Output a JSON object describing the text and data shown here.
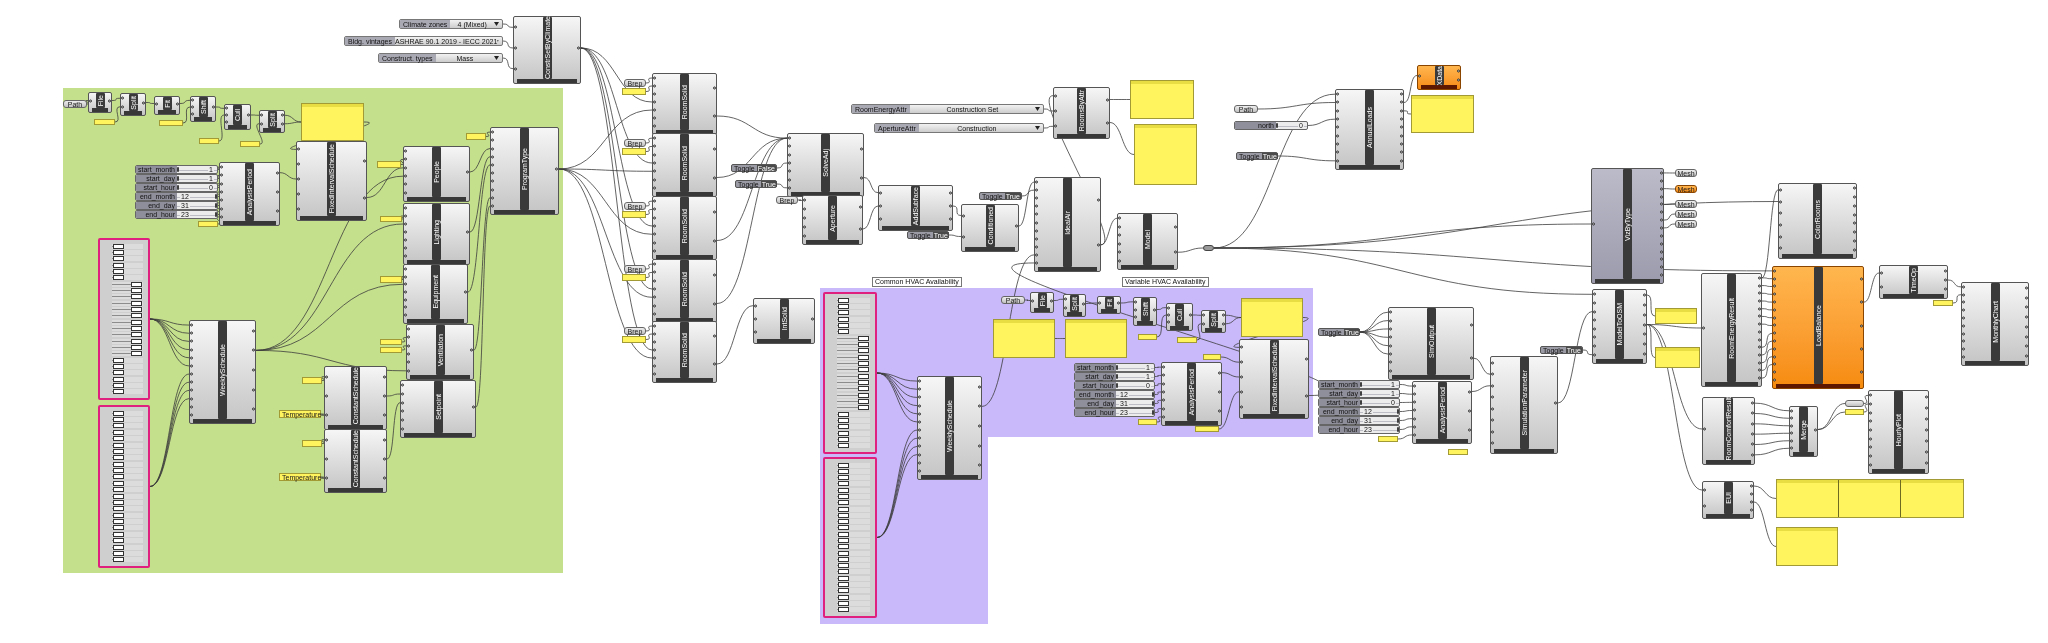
{
  "groups": [
    {
      "color": "#c5e08c"
    },
    {
      "title": "Common HVAC Availability",
      "color": "#c9b9fa"
    },
    {
      "title": "Variable HVAC Availability",
      "color": "#c9b9fa"
    }
  ],
  "nodes": [
    {
      "kind": "value_list",
      "label": "Climate zones",
      "value": "4 (Mixed)"
    },
    {
      "kind": "value_list",
      "label": "Bldg. vintages",
      "value": "ASHRAE 90.1 2019 - IECC 2021"
    },
    {
      "kind": "value_list",
      "label": "Construct. types",
      "value": "Mass"
    },
    {
      "kind": "component",
      "name": "ConstrSetByClimate",
      "warning": false,
      "preview": true
    },
    {
      "kind": "param",
      "text": "Path",
      "warning": false
    },
    {
      "kind": "component",
      "name": "File",
      "warning": false,
      "preview": true
    },
    {
      "kind": "panel"
    },
    {
      "kind": "component",
      "name": "Split",
      "warning": false,
      "preview": true
    },
    {
      "kind": "component",
      "name": "Fit",
      "warning": false,
      "preview": true
    },
    {
      "kind": "panel"
    },
    {
      "kind": "component",
      "name": "Shift",
      "warning": false,
      "preview": true
    },
    {
      "kind": "panel"
    },
    {
      "kind": "component",
      "name": "Cull",
      "warning": false,
      "preview": true
    },
    {
      "kind": "panel"
    },
    {
      "kind": "component",
      "name": "Split",
      "warning": false,
      "preview": true
    },
    {
      "kind": "panel"
    },
    {
      "kind": "slider",
      "label": "start_month",
      "value": "1",
      "level": 0
    },
    {
      "kind": "slider",
      "label": "start_day",
      "value": "1",
      "level": 0
    },
    {
      "kind": "slider",
      "label": "start_hour",
      "value": "0",
      "level": 0
    },
    {
      "kind": "slider",
      "label": "end_month",
      "value": "12",
      "level": 1
    },
    {
      "kind": "slider",
      "label": "end_day",
      "value": "31",
      "level": 1
    },
    {
      "kind": "slider",
      "label": "end_hour",
      "value": "23",
      "level": 1
    },
    {
      "kind": "panel"
    },
    {
      "kind": "component",
      "name": "AnalysisPeriod",
      "warning": false,
      "preview": true
    },
    {
      "kind": "component",
      "name": "FixedIntervalSchedule",
      "warning": false,
      "preview": true
    },
    {
      "kind": "panel"
    },
    {
      "kind": "panel"
    },
    {
      "kind": "component",
      "name": "People",
      "warning": false,
      "preview": true
    },
    {
      "kind": "panel"
    },
    {
      "kind": "component",
      "name": "Lighting",
      "warning": false,
      "preview": true
    },
    {
      "kind": "panel"
    },
    {
      "kind": "component",
      "name": "Equipment",
      "warning": false,
      "preview": true
    },
    {
      "kind": "panel"
    },
    {
      "kind": "panel"
    },
    {
      "kind": "component",
      "name": "Ventilation",
      "warning": false,
      "preview": true
    },
    {
      "kind": "component",
      "name": "ProgramType",
      "warning": false,
      "preview": true
    },
    {
      "kind": "gene_pool",
      "sliders": [
        {
          "level": 0.05
        },
        {
          "level": 0.05
        },
        {
          "level": 0.05
        },
        {
          "level": 0.05
        },
        {
          "level": 0.05
        },
        {
          "level": 0.05
        },
        {
          "level": 0.95
        },
        {
          "level": 0.95
        },
        {
          "level": 0.95
        },
        {
          "level": 0.95
        },
        {
          "level": 0.95
        },
        {
          "level": 0.95
        },
        {
          "level": 0.95
        },
        {
          "level": 0.95
        },
        {
          "level": 0.95
        },
        {
          "level": 0.95
        },
        {
          "level": 0.95
        },
        {
          "level": 0.95
        },
        {
          "level": 0.05
        },
        {
          "level": 0.05
        },
        {
          "level": 0.05
        },
        {
          "level": 0.05
        },
        {
          "level": 0.05
        },
        {
          "level": 0.05
        }
      ]
    },
    {
      "kind": "gene_pool",
      "sliders": [
        {
          "level": 0.05
        },
        {
          "level": 0.05
        },
        {
          "level": 0.05
        },
        {
          "level": 0.05
        },
        {
          "level": 0.05
        },
        {
          "level": 0.05
        },
        {
          "level": 0.05
        },
        {
          "level": 0.05
        },
        {
          "level": 0.05
        },
        {
          "level": 0.05
        },
        {
          "level": 0.05
        },
        {
          "level": 0.05
        },
        {
          "level": 0.05
        },
        {
          "level": 0.05
        },
        {
          "level": 0.05
        },
        {
          "level": 0.05
        },
        {
          "level": 0.05
        },
        {
          "level": 0.05
        },
        {
          "level": 0.05
        },
        {
          "level": 0.05
        },
        {
          "level": 0.05
        },
        {
          "level": 0.05
        },
        {
          "level": 0.05
        },
        {
          "level": 0.05
        }
      ]
    },
    {
      "kind": "component",
      "name": "WeeklySchedule",
      "warning": false,
      "preview": true
    },
    {
      "kind": "panel"
    },
    {
      "kind": "panel",
      "lines": [
        "Temperature"
      ]
    },
    {
      "kind": "component",
      "name": "ConstantSchedule",
      "warning": false,
      "preview": true
    },
    {
      "kind": "panel"
    },
    {
      "kind": "panel",
      "lines": [
        "Temperature"
      ]
    },
    {
      "kind": "component",
      "name": "ConstantSchedule",
      "warning": false,
      "preview": true
    },
    {
      "kind": "component",
      "name": "Setpoint",
      "warning": false,
      "preview": true
    },
    {
      "kind": "param",
      "text": "Brep",
      "warning": false
    },
    {
      "kind": "panel"
    },
    {
      "kind": "component",
      "name": "RoomSolid",
      "warning": false,
      "preview": true
    },
    {
      "kind": "param",
      "text": "Brep",
      "warning": false
    },
    {
      "kind": "panel"
    },
    {
      "kind": "component",
      "name": "RoomSolid",
      "warning": false,
      "preview": true
    },
    {
      "kind": "param",
      "text": "Brep",
      "warning": false
    },
    {
      "kind": "panel"
    },
    {
      "kind": "component",
      "name": "RoomSolid",
      "warning": false,
      "preview": true
    },
    {
      "kind": "param",
      "text": "Brep",
      "warning": false
    },
    {
      "kind": "panel"
    },
    {
      "kind": "component",
      "name": "RoomSolid",
      "warning": false,
      "preview": true
    },
    {
      "kind": "param",
      "text": "Brep",
      "warning": false
    },
    {
      "kind": "panel"
    },
    {
      "kind": "component",
      "name": "RoomSolid",
      "warning": false,
      "preview": true
    },
    {
      "kind": "value_list",
      "label": "RoomEnergyAttr",
      "value": "Construction Set"
    },
    {
      "kind": "value_list",
      "label": "ApertureAttr",
      "value": "Construction"
    },
    {
      "kind": "component",
      "name": "RoomsByAttr",
      "warning": false,
      "preview": true
    },
    {
      "kind": "panel"
    },
    {
      "kind": "panel"
    },
    {
      "kind": "toggle",
      "label": "Toggle",
      "value": "False"
    },
    {
      "kind": "toggle",
      "label": "Toggle",
      "value": "True"
    },
    {
      "kind": "component",
      "name": "SolveAdj",
      "warning": false,
      "preview": true
    },
    {
      "kind": "param",
      "text": "Brep",
      "warning": false
    },
    {
      "kind": "toggle",
      "label": "Toggle",
      "value": "True"
    },
    {
      "kind": "component",
      "name": "Aperture",
      "warning": false,
      "preview": true
    },
    {
      "kind": "component",
      "name": "AddSubface",
      "warning": false,
      "preview": true
    },
    {
      "kind": "component",
      "name": "Conditioned",
      "warning": false,
      "preview": true
    },
    {
      "kind": "toggle",
      "label": "Toggle",
      "value": "True"
    },
    {
      "kind": "component",
      "name": "IdealAir",
      "warning": false,
      "preview": true
    },
    {
      "kind": "component",
      "name": "IntSolid",
      "warning": false,
      "preview": true
    },
    {
      "kind": "component",
      "name": "Model",
      "warning": false,
      "preview": true
    },
    {
      "kind": "relay"
    },
    {
      "kind": "param",
      "text": "Path",
      "warning": false
    },
    {
      "kind": "slider",
      "label": "north",
      "value": "0",
      "level": 0
    },
    {
      "kind": "toggle",
      "label": "Toggle",
      "value": "True"
    },
    {
      "kind": "component",
      "name": "AnnualLoads",
      "warning": false,
      "preview": true
    },
    {
      "kind": "component",
      "name": "XData",
      "warning": true,
      "preview": true
    },
    {
      "kind": "panel"
    },
    {
      "kind": "toggle",
      "label": "Toggle",
      "value": "True"
    },
    {
      "kind": "component",
      "name": "SimOutput",
      "warning": false,
      "preview": true
    },
    {
      "kind": "slider",
      "label": "start_month",
      "value": "1",
      "level": 0
    },
    {
      "kind": "slider",
      "label": "start_day",
      "value": "1",
      "level": 0
    },
    {
      "kind": "slider",
      "label": "start_hour",
      "value": "0",
      "level": 0
    },
    {
      "kind": "slider",
      "label": "end_month",
      "value": "12",
      "level": 1
    },
    {
      "kind": "slider",
      "label": "end_day",
      "value": "31",
      "level": 1
    },
    {
      "kind": "slider",
      "label": "end_hour",
      "value": "23",
      "level": 1
    },
    {
      "kind": "panel"
    },
    {
      "kind": "component",
      "name": "AnalysisPeriod",
      "warning": false,
      "preview": true
    },
    {
      "kind": "panel"
    },
    {
      "kind": "toggle",
      "label": "Toggle",
      "value": "True"
    },
    {
      "kind": "component",
      "name": "SimulationParameter",
      "warning": false,
      "preview": true
    },
    {
      "kind": "gene_pool",
      "sliders": [
        {
          "level": 0.05
        },
        {
          "level": 0.05
        },
        {
          "level": 0.05
        },
        {
          "level": 0.05
        },
        {
          "level": 0.05
        },
        {
          "level": 0.05
        },
        {
          "level": 0.95
        },
        {
          "level": 0.95
        },
        {
          "level": 0.95
        },
        {
          "level": 0.95
        },
        {
          "level": 0.95
        },
        {
          "level": 0.95
        },
        {
          "level": 0.95
        },
        {
          "level": 0.95
        },
        {
          "level": 0.95
        },
        {
          "level": 0.95
        },
        {
          "level": 0.95
        },
        {
          "level": 0.95
        },
        {
          "level": 0.05
        },
        {
          "level": 0.05
        },
        {
          "level": 0.05
        },
        {
          "level": 0.05
        },
        {
          "level": 0.05
        },
        {
          "level": 0.05
        }
      ]
    },
    {
      "kind": "gene_pool",
      "sliders": [
        {
          "level": 0.05
        },
        {
          "level": 0.05
        },
        {
          "level": 0.05
        },
        {
          "level": 0.05
        },
        {
          "level": 0.05
        },
        {
          "level": 0.05
        },
        {
          "level": 0.05
        },
        {
          "level": 0.05
        },
        {
          "level": 0.05
        },
        {
          "level": 0.05
        },
        {
          "level": 0.05
        },
        {
          "level": 0.05
        },
        {
          "level": 0.05
        },
        {
          "level": 0.05
        },
        {
          "level": 0.05
        },
        {
          "level": 0.05
        },
        {
          "level": 0.05
        },
        {
          "level": 0.05
        },
        {
          "level": 0.05
        },
        {
          "level": 0.05
        },
        {
          "level": 0.05
        },
        {
          "level": 0.05
        },
        {
          "level": 0.05
        },
        {
          "level": 0.05
        }
      ]
    },
    {
      "kind": "component",
      "name": "WeeklySchedule",
      "warning": false,
      "preview": true
    },
    {
      "kind": "param",
      "text": "Path",
      "warning": false
    },
    {
      "kind": "component",
      "name": "File",
      "warning": false,
      "preview": true
    },
    {
      "kind": "component",
      "name": "Split",
      "warning": false,
      "preview": true
    },
    {
      "kind": "component",
      "name": "Fit",
      "warning": false,
      "preview": true
    },
    {
      "kind": "component",
      "name": "Shift",
      "warning": false,
      "preview": true
    },
    {
      "kind": "panel"
    },
    {
      "kind": "component",
      "name": "Cull",
      "warning": false,
      "preview": true
    },
    {
      "kind": "panel"
    },
    {
      "kind": "component",
      "name": "Split",
      "warning": false,
      "preview": true
    },
    {
      "kind": "panel"
    },
    {
      "kind": "panel"
    },
    {
      "kind": "panel"
    },
    {
      "kind": "slider",
      "label": "start_month",
      "value": "1",
      "level": 0
    },
    {
      "kind": "slider",
      "label": "start_day",
      "value": "1",
      "level": 0
    },
    {
      "kind": "slider",
      "label": "start_hour",
      "value": "0",
      "level": 0
    },
    {
      "kind": "slider",
      "label": "end_month",
      "value": "12",
      "level": 1
    },
    {
      "kind": "slider",
      "label": "end_day",
      "value": "31",
      "level": 1
    },
    {
      "kind": "slider",
      "label": "end_hour",
      "value": "23",
      "level": 1
    },
    {
      "kind": "panel"
    },
    {
      "kind": "panel"
    },
    {
      "kind": "component",
      "name": "AnalysisPeriod",
      "warning": false,
      "preview": true
    },
    {
      "kind": "panel"
    },
    {
      "kind": "component",
      "name": "FixedIntervalSchedule",
      "warning": false,
      "preview": true
    },
    {
      "kind": "component",
      "name": "VizByType",
      "warning": false,
      "preview": false
    },
    {
      "kind": "param",
      "text": "Mesh",
      "warning": false
    },
    {
      "kind": "param",
      "text": "Mesh",
      "warning": true
    },
    {
      "kind": "param",
      "text": "Mesh",
      "warning": false
    },
    {
      "kind": "param",
      "text": "Mesh",
      "warning": false
    },
    {
      "kind": "param",
      "text": "Mesh",
      "warning": false
    },
    {
      "kind": "component",
      "name": "ModelToOSM",
      "warning": false,
      "preview": true
    },
    {
      "kind": "panel"
    },
    {
      "kind": "panel"
    },
    {
      "kind": "component",
      "name": "ColorRooms",
      "warning": false,
      "preview": true
    },
    {
      "kind": "component",
      "name": "RoomEnergyResult",
      "warning": false,
      "preview": true
    },
    {
      "kind": "component",
      "name": "LoadBalance",
      "warning": true,
      "preview": true
    },
    {
      "kind": "component",
      "name": "TimeOp",
      "warning": false,
      "preview": true
    },
    {
      "kind": "panel"
    },
    {
      "kind": "component",
      "name": "MonthlyChart",
      "warning": false,
      "preview": true
    },
    {
      "kind": "component",
      "name": "RoomComfortResult",
      "warning": false,
      "preview": true
    },
    {
      "kind": "component",
      "name": "Merge",
      "warning": false,
      "preview": true
    },
    {
      "kind": "param",
      "warning": false
    },
    {
      "kind": "panel"
    },
    {
      "kind": "component",
      "name": "HourlyPlot",
      "warning": false,
      "preview": true
    },
    {
      "kind": "component",
      "name": "EUI",
      "warning": false,
      "preview": true
    },
    {
      "kind": "panel"
    },
    {
      "kind": "panel"
    }
  ]
}
